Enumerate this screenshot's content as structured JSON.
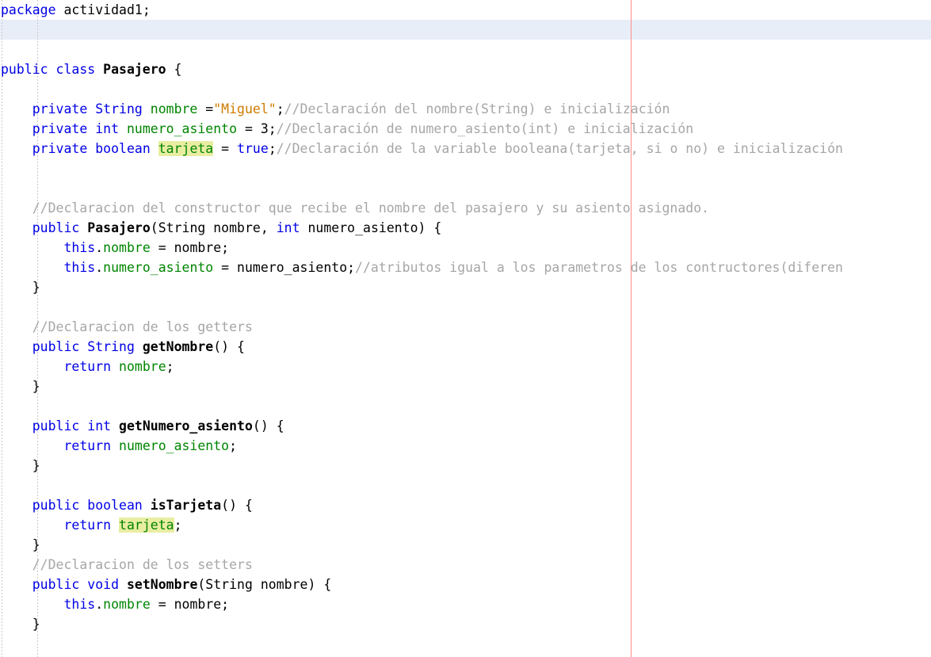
{
  "editor": {
    "language": "java",
    "file_class": "Pasajero",
    "package": "actividad1",
    "colors": {
      "background": "#ffffff",
      "keyword": "#0000e6",
      "field": "#008500",
      "string": "#ce7b00",
      "comment": "#a6a6a6",
      "plain": "#000000",
      "current_line": "#e8eef8",
      "margin_line": "#ff8a8a",
      "occurrence_highlight": "#e9eda2",
      "indent_guide": "#c8c8c8"
    },
    "current_line_index": 1,
    "margin_line_column": 80
  },
  "code": {
    "lines": [
      {
        "n": 1,
        "tokens": [
          {
            "t": "package ",
            "c": "kw"
          },
          {
            "t": "actividad1;",
            "c": "plain"
          }
        ]
      },
      {
        "n": 2,
        "tokens": []
      },
      {
        "n": 3,
        "tokens": []
      },
      {
        "n": 4,
        "tokens": [
          {
            "t": "public class ",
            "c": "kw"
          },
          {
            "t": "Pasajero",
            "c": "cls"
          },
          {
            "t": " {",
            "c": "plain"
          }
        ]
      },
      {
        "n": 5,
        "tokens": []
      },
      {
        "n": 6,
        "tokens": [
          {
            "t": "    ",
            "c": "plain"
          },
          {
            "t": "private String ",
            "c": "kw"
          },
          {
            "t": "nombre",
            "c": "fld"
          },
          {
            "t": " =",
            "c": "plain"
          },
          {
            "t": "\"Miguel\"",
            "c": "str"
          },
          {
            "t": ";",
            "c": "plain"
          },
          {
            "t": "//Declaración del nombre(String) e inicialización",
            "c": "cmt"
          }
        ]
      },
      {
        "n": 7,
        "tokens": [
          {
            "t": "    ",
            "c": "plain"
          },
          {
            "t": "private int ",
            "c": "kw"
          },
          {
            "t": "numero_asiento",
            "c": "fld"
          },
          {
            "t": " = 3;",
            "c": "plain"
          },
          {
            "t": "//Declaración de numero_asiento(int) e inicialización",
            "c": "cmt"
          }
        ]
      },
      {
        "n": 8,
        "tokens": [
          {
            "t": "    ",
            "c": "plain"
          },
          {
            "t": "private boolean ",
            "c": "kw"
          },
          {
            "t": "tarjeta",
            "c": "fld hl"
          },
          {
            "t": " = ",
            "c": "plain"
          },
          {
            "t": "true",
            "c": "kw"
          },
          {
            "t": ";",
            "c": "plain"
          },
          {
            "t": "//Declaración de la variable booleana(tarjeta, si o no) e inicialización",
            "c": "cmt"
          }
        ]
      },
      {
        "n": 9,
        "tokens": []
      },
      {
        "n": 10,
        "tokens": []
      },
      {
        "n": 11,
        "tokens": [
          {
            "t": "    ",
            "c": "plain"
          },
          {
            "t": "//Declaracion del constructor que recibe el nombre del pasajero y su asiento asignado.",
            "c": "cmt"
          }
        ]
      },
      {
        "n": 12,
        "tokens": [
          {
            "t": "    ",
            "c": "plain"
          },
          {
            "t": "public ",
            "c": "kw"
          },
          {
            "t": "Pasajero",
            "c": "cls"
          },
          {
            "t": "(String nombre, ",
            "c": "plain"
          },
          {
            "t": "int",
            "c": "kw"
          },
          {
            "t": " numero_asiento) {",
            "c": "plain"
          }
        ]
      },
      {
        "n": 13,
        "tokens": [
          {
            "t": "        ",
            "c": "plain"
          },
          {
            "t": "this",
            "c": "kw"
          },
          {
            "t": ".",
            "c": "plain"
          },
          {
            "t": "nombre",
            "c": "fld"
          },
          {
            "t": " = nombre;",
            "c": "plain"
          }
        ]
      },
      {
        "n": 14,
        "tokens": [
          {
            "t": "        ",
            "c": "plain"
          },
          {
            "t": "this",
            "c": "kw"
          },
          {
            "t": ".",
            "c": "plain"
          },
          {
            "t": "numero_asiento",
            "c": "fld"
          },
          {
            "t": " = numero_asiento;",
            "c": "plain"
          },
          {
            "t": "//atributos igual a los parametros de los contructores(diferen",
            "c": "cmt"
          }
        ]
      },
      {
        "n": 15,
        "tokens": [
          {
            "t": "    }",
            "c": "plain"
          }
        ]
      },
      {
        "n": 16,
        "tokens": []
      },
      {
        "n": 17,
        "tokens": [
          {
            "t": "    ",
            "c": "plain"
          },
          {
            "t": "//Declaracion de los getters",
            "c": "cmt"
          }
        ]
      },
      {
        "n": 18,
        "tokens": [
          {
            "t": "    ",
            "c": "plain"
          },
          {
            "t": "public String ",
            "c": "kw"
          },
          {
            "t": "getNombre",
            "c": "mth"
          },
          {
            "t": "() {",
            "c": "plain"
          }
        ]
      },
      {
        "n": 19,
        "tokens": [
          {
            "t": "        ",
            "c": "plain"
          },
          {
            "t": "return ",
            "c": "kw"
          },
          {
            "t": "nombre",
            "c": "fld"
          },
          {
            "t": ";",
            "c": "plain"
          }
        ]
      },
      {
        "n": 20,
        "tokens": [
          {
            "t": "    }",
            "c": "plain"
          }
        ]
      },
      {
        "n": 21,
        "tokens": []
      },
      {
        "n": 22,
        "tokens": [
          {
            "t": "    ",
            "c": "plain"
          },
          {
            "t": "public int ",
            "c": "kw"
          },
          {
            "t": "getNumero_asiento",
            "c": "mth"
          },
          {
            "t": "() {",
            "c": "plain"
          }
        ]
      },
      {
        "n": 23,
        "tokens": [
          {
            "t": "        ",
            "c": "plain"
          },
          {
            "t": "return ",
            "c": "kw"
          },
          {
            "t": "numero_asiento",
            "c": "fld"
          },
          {
            "t": ";",
            "c": "plain"
          }
        ]
      },
      {
        "n": 24,
        "tokens": [
          {
            "t": "    }",
            "c": "plain"
          }
        ]
      },
      {
        "n": 25,
        "tokens": []
      },
      {
        "n": 26,
        "tokens": [
          {
            "t": "    ",
            "c": "plain"
          },
          {
            "t": "public boolean ",
            "c": "kw"
          },
          {
            "t": "isTarjeta",
            "c": "mth"
          },
          {
            "t": "() {",
            "c": "plain"
          }
        ]
      },
      {
        "n": 27,
        "tokens": [
          {
            "t": "        ",
            "c": "plain"
          },
          {
            "t": "return ",
            "c": "kw"
          },
          {
            "t": "tarjeta",
            "c": "fld hl"
          },
          {
            "t": ";",
            "c": "plain"
          }
        ]
      },
      {
        "n": 28,
        "tokens": [
          {
            "t": "    }",
            "c": "plain"
          }
        ]
      },
      {
        "n": 29,
        "tokens": [
          {
            "t": "    ",
            "c": "plain"
          },
          {
            "t": "//Declaracion de los setters",
            "c": "cmt"
          }
        ]
      },
      {
        "n": 30,
        "tokens": [
          {
            "t": "    ",
            "c": "plain"
          },
          {
            "t": "public void ",
            "c": "kw"
          },
          {
            "t": "setNombre",
            "c": "mth"
          },
          {
            "t": "(String nombre) {",
            "c": "plain"
          }
        ]
      },
      {
        "n": 31,
        "tokens": [
          {
            "t": "        ",
            "c": "plain"
          },
          {
            "t": "this",
            "c": "kw"
          },
          {
            "t": ".",
            "c": "plain"
          },
          {
            "t": "nombre",
            "c": "fld"
          },
          {
            "t": " = nombre;",
            "c": "plain"
          }
        ]
      },
      {
        "n": 32,
        "tokens": [
          {
            "t": "    }",
            "c": "plain"
          }
        ]
      }
    ]
  }
}
